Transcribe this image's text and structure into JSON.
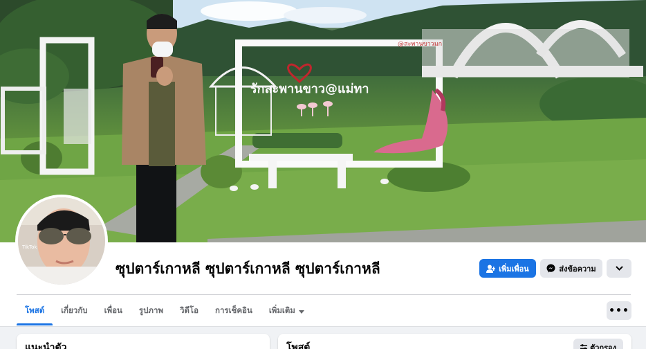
{
  "profile": {
    "name": "ซุปตาร์เกาหลี ซุปตาร์เกาหลี ซุปตาร์เกาหลี"
  },
  "cover": {
    "sign_left": "@สะพานขาวมก",
    "sign_main": "รักสะพานขาว@แม่ทา"
  },
  "avatar": {
    "tag": "TikTok"
  },
  "actions": {
    "add_friend": "เพิ่มเพื่อน",
    "message": "ส่งข้อความ"
  },
  "tabs": [
    {
      "label": "โพสต์",
      "active": true
    },
    {
      "label": "เกี่ยวกับ",
      "active": false
    },
    {
      "label": "เพื่อน",
      "active": false
    },
    {
      "label": "รูปภาพ",
      "active": false
    },
    {
      "label": "วิดีโอ",
      "active": false
    },
    {
      "label": "การเช็คอิน",
      "active": false
    },
    {
      "label": "เพิ่มเติม",
      "active": false
    }
  ],
  "more_button": "•••",
  "cards": {
    "intro_title": "แนะนำตัว",
    "posts_title": "โพสต์",
    "filter_label": "ตัวกรอง"
  },
  "colors": {
    "accent": "#1b74e4",
    "background": "#f0f2f5",
    "secondary_button": "#e4e6eb"
  }
}
